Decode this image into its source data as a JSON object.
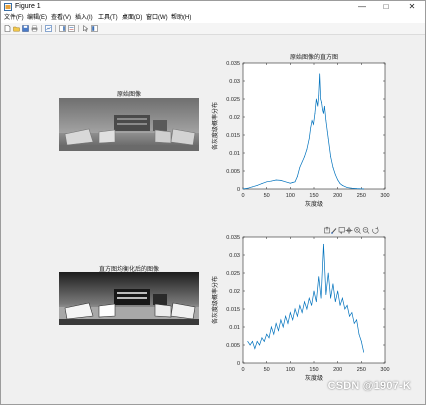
{
  "window": {
    "title": "Figure 1",
    "minimize_symbol": "—",
    "maximize_symbol": "□",
    "close_symbol": "✕"
  },
  "menu": [
    "文件(F)",
    "编辑(E)",
    "查看(V)",
    "插入(I)",
    "工具(T)",
    "桌面(D)",
    "窗口(W)",
    "帮助(H)"
  ],
  "toolbar_icons": [
    "new-figure-icon",
    "open-file-icon",
    "save-icon",
    "print-icon",
    "link-plot-icon",
    "insert-colorbar-icon",
    "insert-legend-icon",
    "edit-plot-arrow-icon",
    "open-property-inspector-icon"
  ],
  "axes_toolbar_icons": [
    "export-icon",
    "brush-icon",
    "datatip-icon",
    "pan-icon",
    "zoom-in-icon",
    "zoom-out-icon",
    "restore-view-icon"
  ],
  "subplot_titles": {
    "original_image": "原始图像",
    "equalized_image": "直方图均衡化后的图像"
  },
  "colors": {
    "plot_line": "#0072bd",
    "figure_bg": "#f0f0f0"
  },
  "watermark": "CSDN @1907-K",
  "chart_data": [
    {
      "type": "line",
      "title": "原始图像的直方图",
      "xlabel": "灰度级",
      "ylabel": "各灰度级概率分布",
      "xlim": [
        0,
        300
      ],
      "ylim": [
        0,
        0.035
      ],
      "xticks": [
        "0",
        "50",
        "100",
        "150",
        "200",
        "250",
        "300"
      ],
      "yticks": [
        "0",
        "0.005",
        "0.01",
        "0.015",
        "0.02",
        "0.025",
        "0.03",
        "0.035"
      ],
      "grid": false,
      "x": [
        0,
        10,
        20,
        30,
        40,
        50,
        60,
        70,
        80,
        90,
        100,
        105,
        110,
        115,
        120,
        125,
        130,
        135,
        140,
        143,
        146,
        149,
        152,
        155,
        158,
        160,
        162,
        164,
        166,
        168,
        170,
        172,
        175,
        178,
        180,
        185,
        190,
        195,
        200,
        205,
        210,
        220,
        230,
        240,
        255
      ],
      "y": [
        0,
        0.0002,
        0.0006,
        0.001,
        0.0015,
        0.002,
        0.0022,
        0.0025,
        0.0024,
        0.002,
        0.0016,
        0.0018,
        0.002,
        0.0035,
        0.006,
        0.0075,
        0.009,
        0.011,
        0.014,
        0.017,
        0.019,
        0.018,
        0.021,
        0.025,
        0.023,
        0.026,
        0.032,
        0.025,
        0.024,
        0.022,
        0.021,
        0.023,
        0.019,
        0.016,
        0.014,
        0.009,
        0.006,
        0.004,
        0.0025,
        0.0015,
        0.001,
        0.0004,
        0.0002,
        0.0001,
        0
      ]
    },
    {
      "type": "line",
      "title": "",
      "xlabel": "灰度级",
      "ylabel": "各灰度级概率分布",
      "xlim": [
        0,
        300
      ],
      "ylim": [
        0,
        0.035
      ],
      "xticks": [
        "0",
        "50",
        "100",
        "150",
        "200",
        "250",
        "300"
      ],
      "yticks": [
        "0",
        "0.005",
        "0.01",
        "0.015",
        "0.02",
        "0.025",
        "0.03",
        "0.035"
      ],
      "grid": false,
      "x": [
        10,
        15,
        20,
        25,
        30,
        35,
        40,
        45,
        50,
        55,
        60,
        65,
        70,
        75,
        80,
        85,
        90,
        95,
        100,
        105,
        110,
        115,
        120,
        125,
        130,
        135,
        140,
        145,
        150,
        155,
        160,
        165,
        170,
        175,
        180,
        185,
        190,
        195,
        200,
        205,
        210,
        215,
        220,
        225,
        230,
        235,
        240,
        245,
        250,
        255
      ],
      "y": [
        0.006,
        0.005,
        0.006,
        0.004,
        0.006,
        0.005,
        0.007,
        0.006,
        0.008,
        0.007,
        0.01,
        0.008,
        0.011,
        0.009,
        0.012,
        0.01,
        0.013,
        0.011,
        0.014,
        0.012,
        0.015,
        0.013,
        0.016,
        0.014,
        0.017,
        0.015,
        0.018,
        0.016,
        0.02,
        0.017,
        0.024,
        0.018,
        0.033,
        0.019,
        0.025,
        0.018,
        0.022,
        0.017,
        0.02,
        0.016,
        0.018,
        0.015,
        0.016,
        0.013,
        0.014,
        0.011,
        0.012,
        0.008,
        0.006,
        0.003
      ]
    }
  ]
}
